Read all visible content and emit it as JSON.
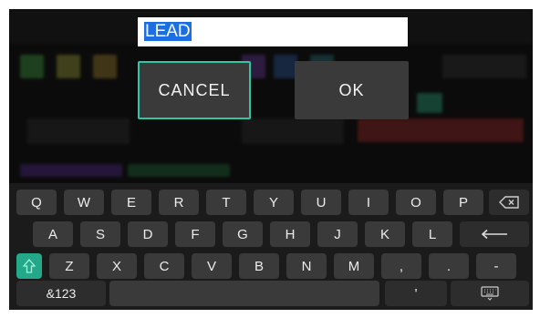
{
  "dialog": {
    "input_value": "LEAD",
    "cancel_label": "CANCEL",
    "ok_label": "OK"
  },
  "keyboard": {
    "row1": [
      "Q",
      "W",
      "E",
      "R",
      "T",
      "Y",
      "U",
      "I",
      "O",
      "P"
    ],
    "row2": [
      "A",
      "S",
      "D",
      "F",
      "G",
      "H",
      "J",
      "K",
      "L"
    ],
    "row3": [
      "Z",
      "X",
      "C",
      "V",
      "B",
      "N",
      "M",
      ",",
      "."
    ],
    "row3_extra": "-",
    "symbols_label": "&123",
    "apostrophe": "'",
    "icons": {
      "backspace": "backspace-icon",
      "enter": "enter-icon",
      "shift": "shift-icon",
      "hide_keyboard": "keyboard-icon"
    }
  },
  "colors": {
    "accent": "#2fc6a4",
    "shift_active": "#23a98a",
    "selection": "#1d6fe0",
    "key": "#3a3a3a",
    "keyboard_bg": "#1b1b1b"
  }
}
